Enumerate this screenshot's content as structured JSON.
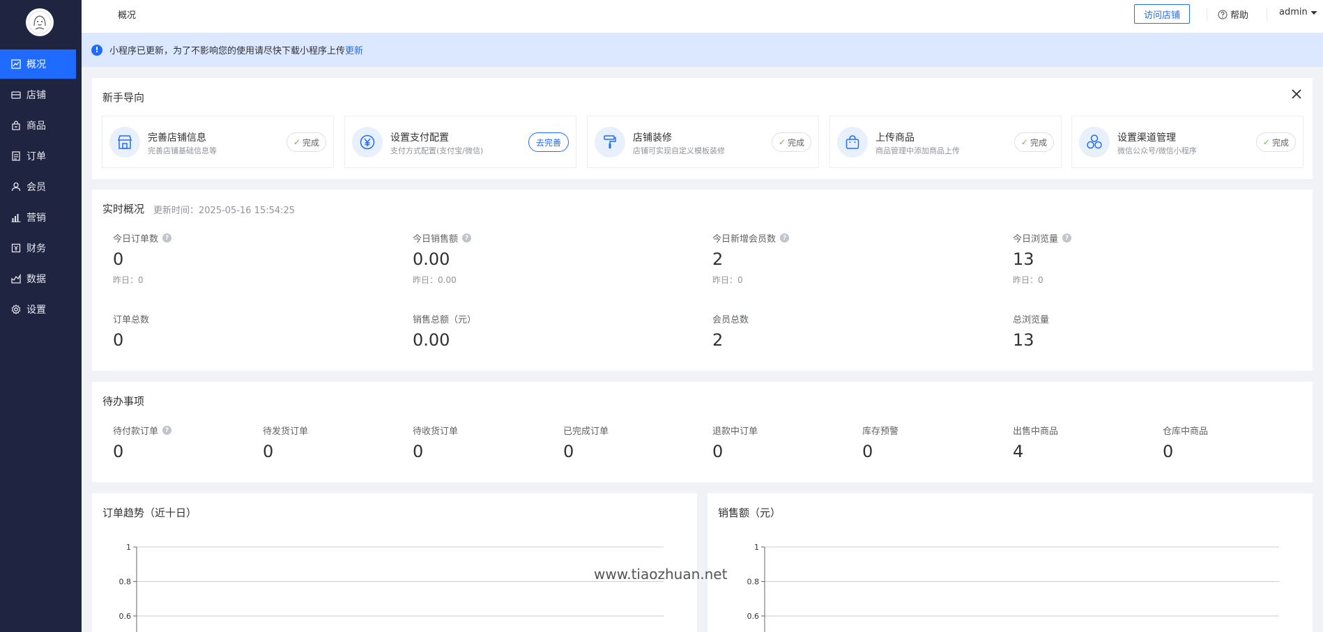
{
  "header": {
    "breadcrumb": "概况",
    "visit_store": "访问店铺",
    "help": "帮助",
    "user": "admin"
  },
  "sidebar": {
    "items": [
      {
        "label": "概况",
        "icon": "chart-line-icon"
      },
      {
        "label": "店铺",
        "icon": "store-icon"
      },
      {
        "label": "商品",
        "icon": "bag-icon"
      },
      {
        "label": "订单",
        "icon": "list-icon"
      },
      {
        "label": "会员",
        "icon": "user-icon"
      },
      {
        "label": "营销",
        "icon": "bar-chart-icon"
      },
      {
        "label": "财务",
        "icon": "yuan-icon"
      },
      {
        "label": "数据",
        "icon": "data-icon"
      },
      {
        "label": "设置",
        "icon": "gear-icon"
      }
    ]
  },
  "notice": {
    "text": "小程序已更新，为了不影响您的使用请尽快下载小程序上传",
    "link": "更新"
  },
  "guide": {
    "title": "新手导向",
    "items": [
      {
        "title": "完善店铺信息",
        "sub": "完善店铺基础信息等",
        "status": "完成",
        "done": true,
        "icon": "store-icon"
      },
      {
        "title": "设置支付配置",
        "sub": "支付方式配置(支付宝/微信)",
        "status": "去完善",
        "done": false,
        "icon": "yuan-icon"
      },
      {
        "title": "店铺装修",
        "sub": "店铺可实现自定义模板装修",
        "status": "完成",
        "done": true,
        "icon": "paint-roller-icon"
      },
      {
        "title": "上传商品",
        "sub": "商品管理中添加商品上传",
        "status": "完成",
        "done": true,
        "icon": "shopping-bag-icon"
      },
      {
        "title": "设置渠道管理",
        "sub": "微信公众号/微信小程序",
        "status": "完成",
        "done": true,
        "icon": "channels-icon"
      }
    ]
  },
  "realtime": {
    "title": "实时概况",
    "updated": "更新时间：2025-05-16 15:54:25",
    "today": [
      {
        "label": "今日订单数",
        "value": "0",
        "yesterday": "昨日：0"
      },
      {
        "label": "今日销售额",
        "value": "0.00",
        "yesterday": "昨日：0.00"
      },
      {
        "label": "今日新增会员数",
        "value": "2",
        "yesterday": "昨日：0"
      },
      {
        "label": "今日浏览量",
        "value": "13",
        "yesterday": "昨日：0"
      }
    ],
    "totals": [
      {
        "label": "订单总数",
        "value": "0"
      },
      {
        "label": "销售总额（元）",
        "value": "0.00"
      },
      {
        "label": "会员总数",
        "value": "2"
      },
      {
        "label": "总浏览量",
        "value": "13"
      }
    ]
  },
  "todo": {
    "title": "待办事项",
    "items": [
      {
        "label": "待付款订单",
        "value": "0"
      },
      {
        "label": "待发货订单",
        "value": "0"
      },
      {
        "label": "待收货订单",
        "value": "0"
      },
      {
        "label": "已完成订单",
        "value": "0"
      },
      {
        "label": "退款中订单",
        "value": "0"
      },
      {
        "label": "库存预警",
        "value": "0"
      },
      {
        "label": "出售中商品",
        "value": "4"
      },
      {
        "label": "仓库中商品",
        "value": "0"
      }
    ]
  },
  "chart_data": [
    {
      "type": "line",
      "title": "订单趋势（近十日）",
      "yticks": [
        "1",
        "0.8",
        "0.6"
      ],
      "ylim": [
        0,
        1
      ],
      "grid": true
    },
    {
      "type": "line",
      "title": "销售额（元）",
      "yticks": [
        "1",
        "0.8",
        "0.6"
      ],
      "ylim": [
        0,
        1
      ],
      "grid": true
    }
  ],
  "watermark": "www.tiaozhuan.net",
  "colors": {
    "sidebar_bg": "#1f2540",
    "accent": "#1f6bff",
    "notice_bg": "#dbe8ff",
    "success": "#67c23a"
  }
}
